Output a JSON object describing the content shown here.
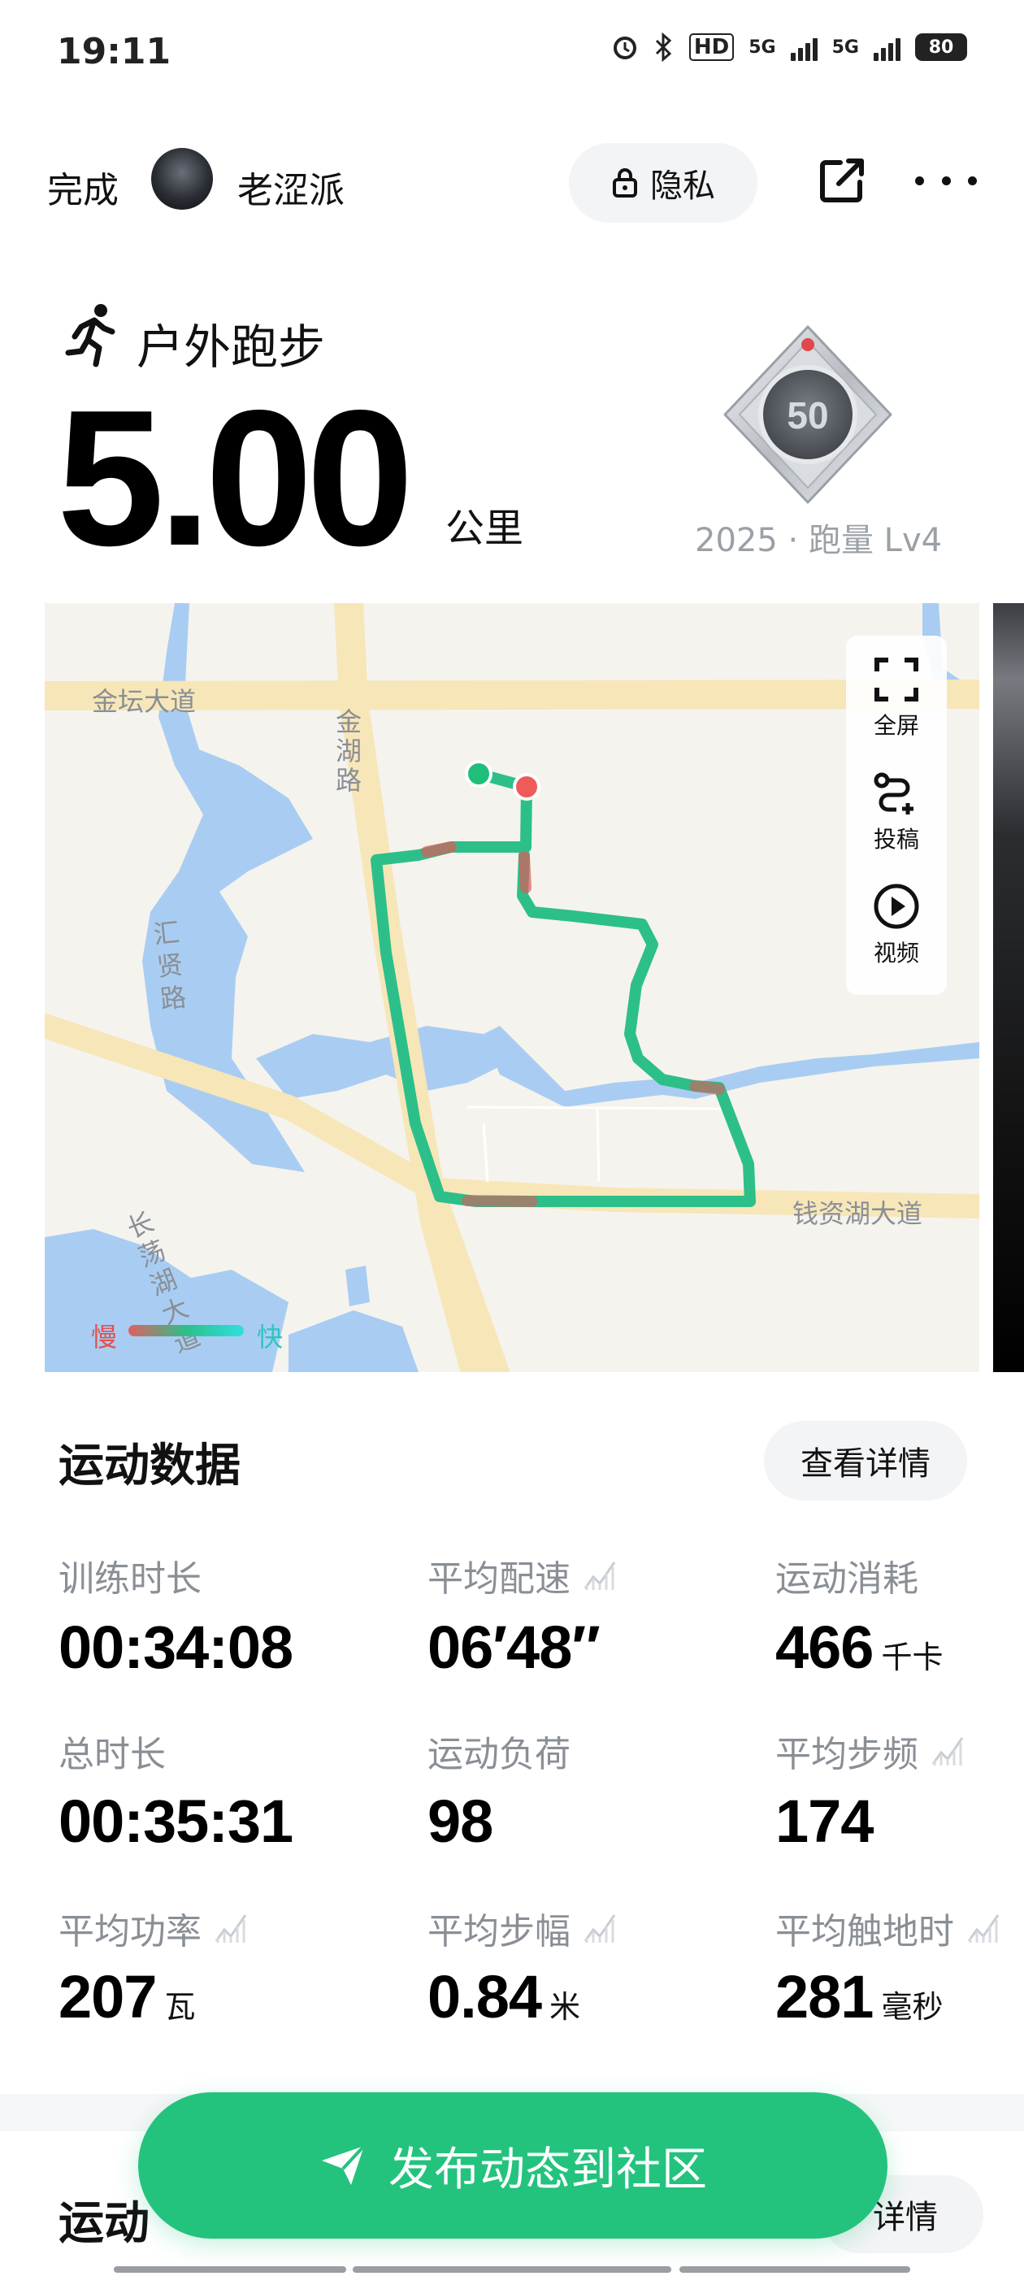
{
  "status_bar": {
    "time": "19:11",
    "hd_label": "HD",
    "signal1_label": "5G",
    "signal2_label": "5G",
    "battery": "80"
  },
  "header": {
    "done_label": "完成",
    "username": "老涩派",
    "privacy_label": "隐私",
    "share_icon": "share-icon",
    "more_icon": "more-icon"
  },
  "activity": {
    "type": "户外跑步",
    "distance": "5.00",
    "unit": "公里",
    "medal_number": "50",
    "medal_caption": "2025 · 跑量 Lv4"
  },
  "map": {
    "tools": [
      {
        "label": "全屏",
        "icon": "fullscreen-icon"
      },
      {
        "label": "投稿",
        "icon": "route-submit-icon"
      },
      {
        "label": "视频",
        "icon": "play-video-icon"
      }
    ],
    "road_labels": {
      "jintan": "金坛大道",
      "jinhu": "金湖路",
      "huixian": "汇贤路",
      "qianzihu": "钱资湖大道",
      "changdang": "长荡湖大道"
    },
    "legend": {
      "slow": "慢",
      "fast": "快"
    },
    "colors": {
      "route": "#2dbf8a",
      "slow": "#e05a5a",
      "fast": "#2ee0e0",
      "water": "#a9cdf2",
      "road": "#f7e6b8"
    }
  },
  "stats": {
    "title": "运动数据",
    "details_label": "查看详情",
    "items": [
      {
        "label": "训练时长",
        "value": "00:34:08",
        "unit": "",
        "trend": false
      },
      {
        "label": "平均配速",
        "value": "06′48″",
        "unit": "",
        "trend": true
      },
      {
        "label": "运动消耗",
        "value": "466",
        "unit": "千卡",
        "trend": false
      },
      {
        "label": "总时长",
        "value": "00:35:31",
        "unit": "",
        "trend": false
      },
      {
        "label": "运动负荷",
        "value": "98",
        "unit": "",
        "trend": false
      },
      {
        "label": "平均步频",
        "value": "174",
        "unit": "",
        "trend": true
      },
      {
        "label": "平均功率",
        "value": "207",
        "unit": "瓦",
        "trend": true
      },
      {
        "label": "平均步幅",
        "value": "0.84",
        "unit": "米",
        "trend": true
      },
      {
        "label": "平均触地时",
        "value": "281",
        "unit": "毫秒",
        "trend": true
      }
    ]
  },
  "section2": {
    "title": "运动",
    "details_label": "详情"
  },
  "publish": {
    "label": "发布动态到社区",
    "color": "#23c37e"
  }
}
